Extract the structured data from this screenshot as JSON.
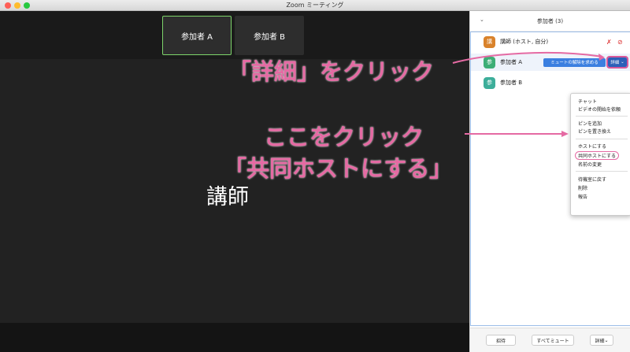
{
  "window": {
    "title": "Zoom ミーティング"
  },
  "video": {
    "thumbnails": [
      {
        "label": "参加者 A"
      },
      {
        "label": "参加者 B"
      }
    ],
    "main_speaker": "講師"
  },
  "panel": {
    "title": "参加者 (3)",
    "participants": [
      {
        "avatar_char": "講",
        "avatar_color": "#d9822b",
        "name": "講師 (ホスト, 自分)"
      },
      {
        "avatar_char": "参",
        "avatar_color": "#3dae76",
        "name": "参加者 A"
      },
      {
        "avatar_char": "参",
        "avatar_color": "#3dae9a",
        "name": "参加者 B"
      }
    ],
    "unmute_request_label": "ミュートの解除を求める",
    "more_label": "詳細",
    "menu_items": [
      "チャット",
      "ビデオの開始を依頼",
      "ピンを追加",
      "ピンを置き換え",
      "ホストにする",
      "共同ホストにする",
      "名前の変更",
      "待機室に戻す",
      "削除",
      "報告"
    ],
    "footer": {
      "invite": "招待",
      "mute_all": "すべてミュート",
      "more": "詳細"
    }
  },
  "annotations": {
    "click_more": "「詳細」をクリック",
    "click_here": "ここをクリック",
    "make_cohost": "「共同ホストにする」",
    "color": "#e56aa3"
  }
}
